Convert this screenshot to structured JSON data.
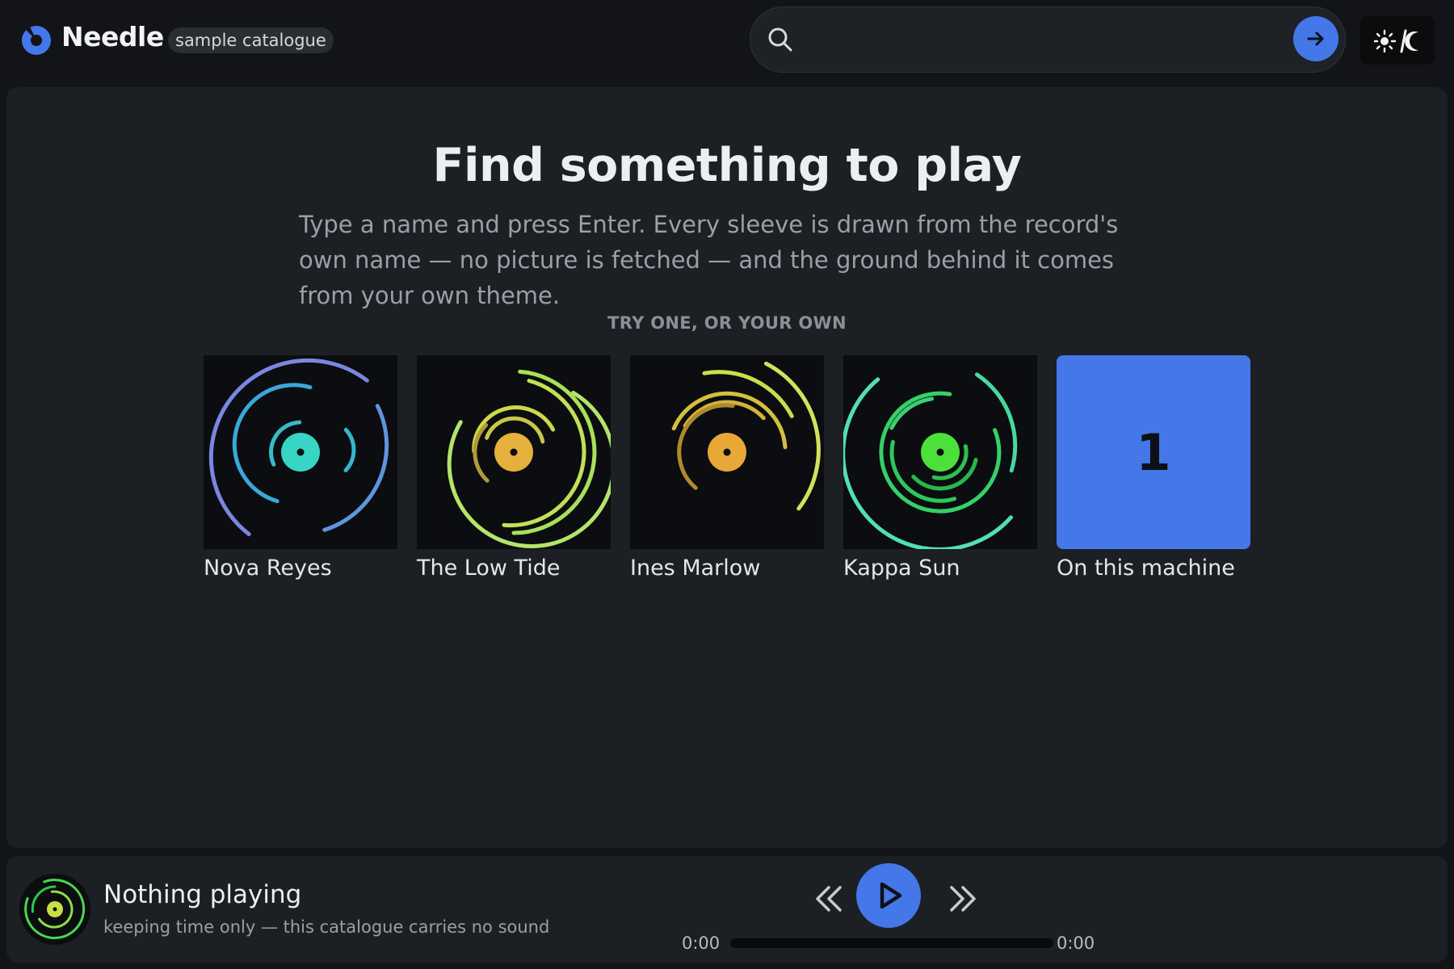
{
  "header": {
    "brand": "Needle",
    "badge": "sample catalogue",
    "search_placeholder": "",
    "search_value": "",
    "theme_toggle_label": "☀/☾"
  },
  "main": {
    "title": "Find something to play",
    "subtitle": "Type a name and press Enter. Every sleeve is drawn from the record's own name — no picture is fetched — and the ground behind it comes from your own theme.",
    "try_label": "TRY ONE, OR YOUR OWN",
    "sleeves": [
      {
        "name": "Nova Reyes",
        "colors": [
          "#7a86e0",
          "#3aa8d8",
          "#38d4c4"
        ]
      },
      {
        "name": "The Low Tide",
        "colors": [
          "#b4e46a",
          "#cfd84a",
          "#e6b03c"
        ]
      },
      {
        "name": "Ines Marlow",
        "colors": [
          "#d2e25a",
          "#d4b238",
          "#e8a838"
        ]
      },
      {
        "name": "Kappa Sun",
        "colors": [
          "#52e0b0",
          "#36d068",
          "#4ce03a"
        ]
      }
    ],
    "local": {
      "name": "On this machine",
      "count": "1"
    }
  },
  "player": {
    "title": "Nothing playing",
    "subtitle": "keeping time only — this catalogue carries no sound",
    "time_current": "0:00",
    "time_total": "0:00",
    "progress": 0
  },
  "colors": {
    "accent": "#4477e8",
    "background": "#121417",
    "panel": "#1c1f23"
  },
  "icons": {
    "logo": "vinyl-logo-icon",
    "search": "search-icon",
    "submit": "arrow-right-icon",
    "theme": "sun-moon-icon",
    "prev": "rewind-icon",
    "play": "play-icon",
    "next": "fast-forward-icon"
  }
}
